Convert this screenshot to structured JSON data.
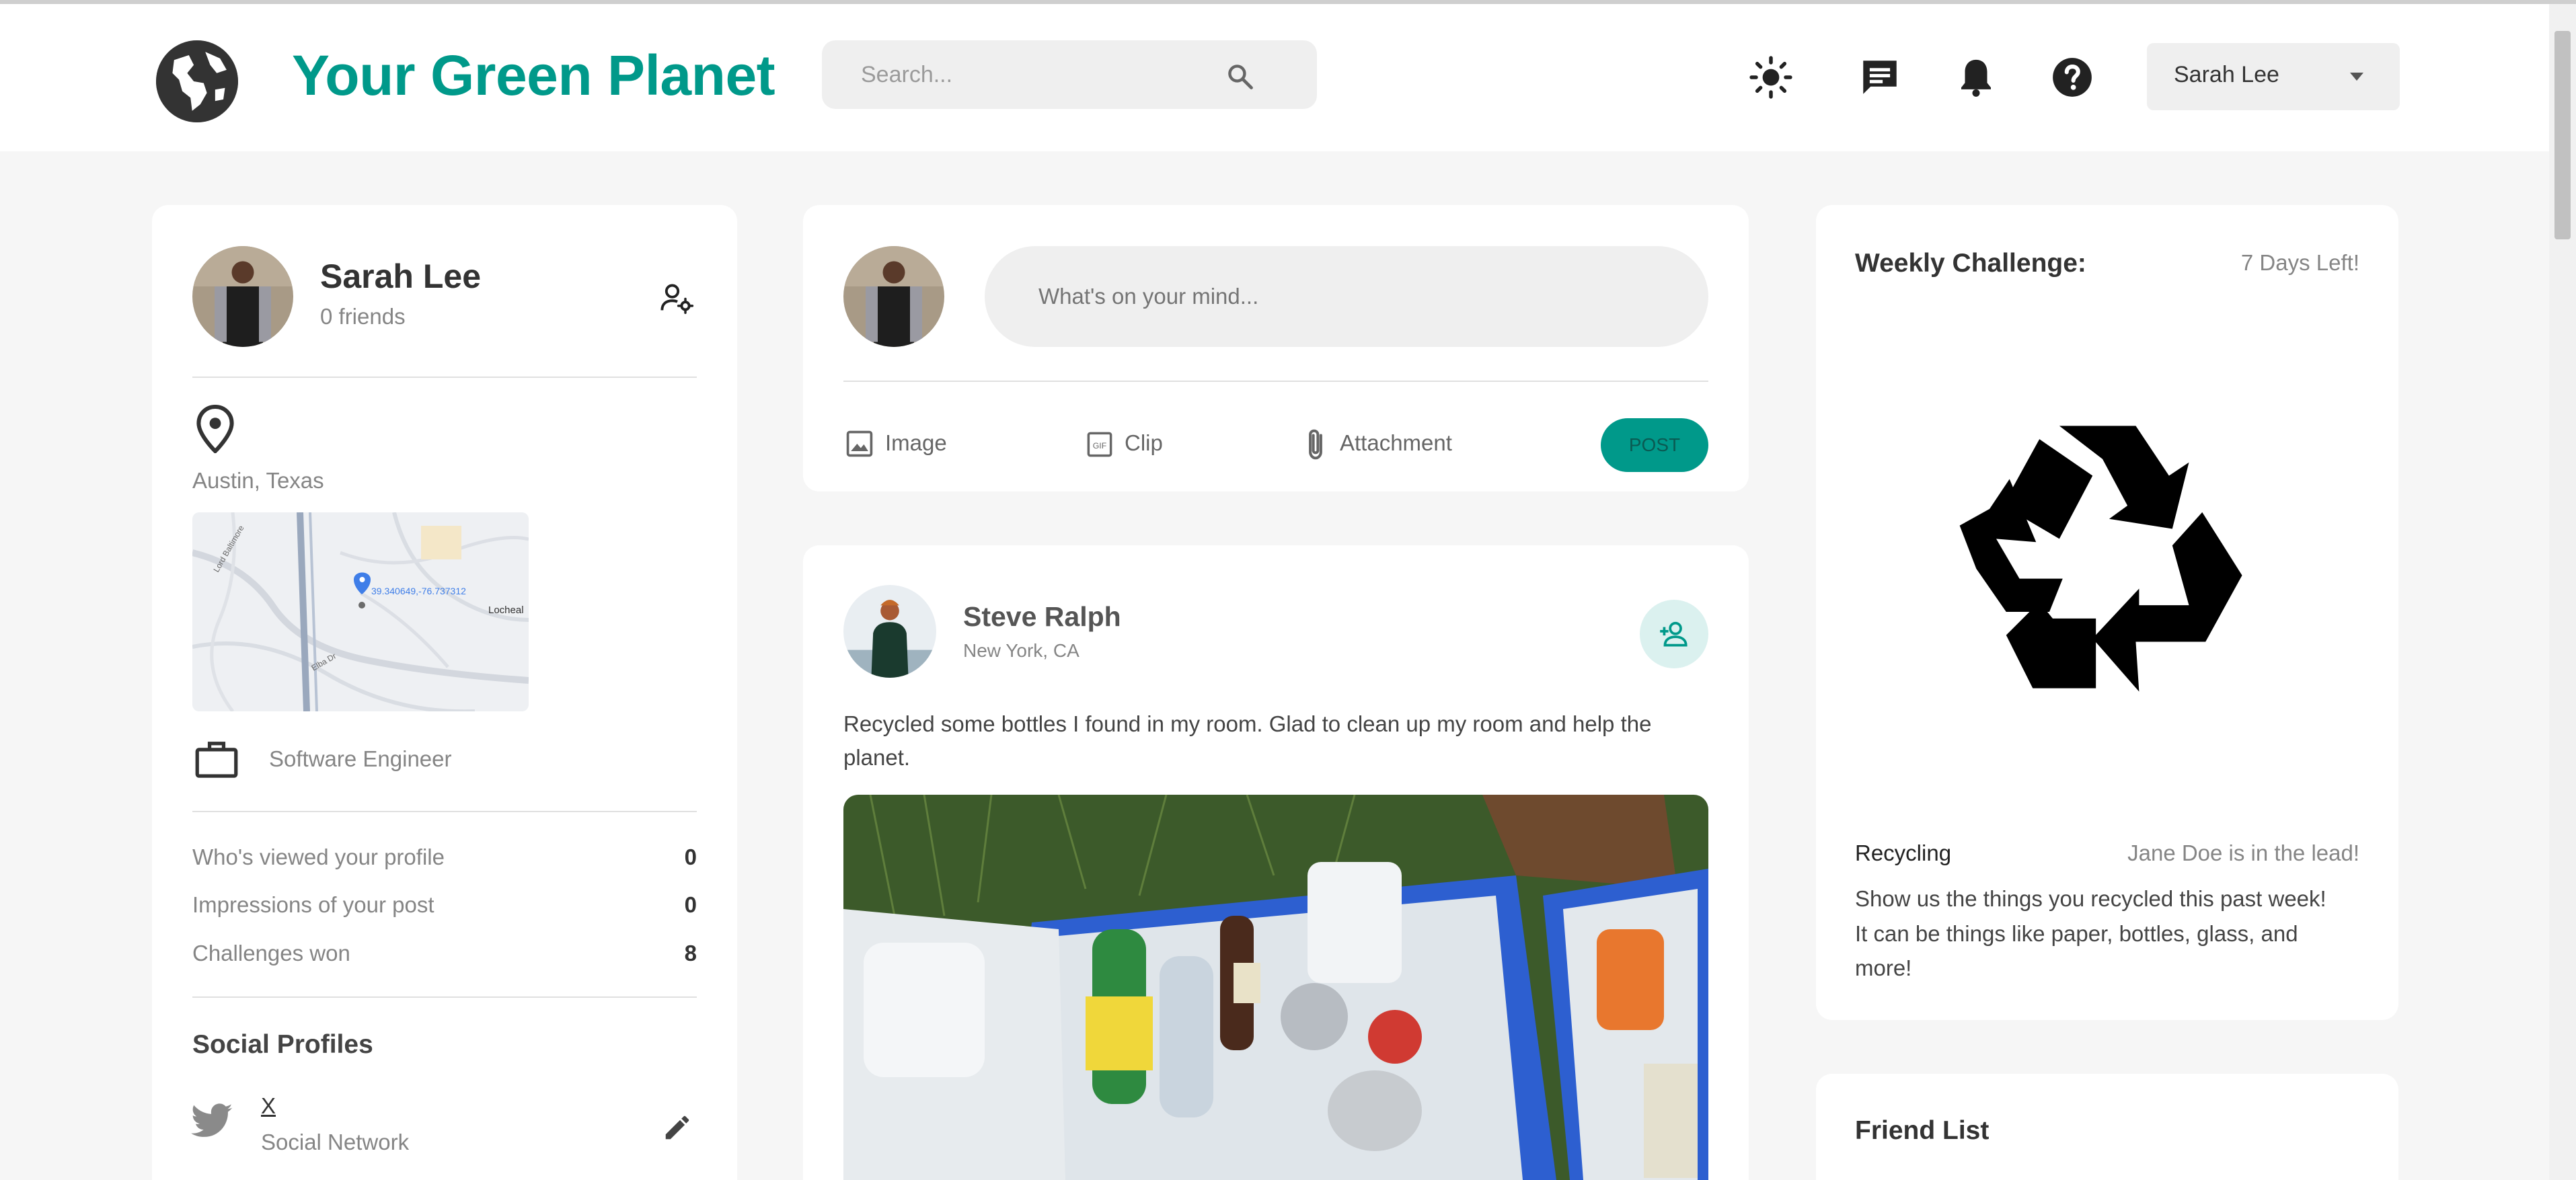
{
  "app": {
    "title": "Your Green Planet",
    "accent_color": "#00998a"
  },
  "header": {
    "search_placeholder": "Search...",
    "icons": [
      "light-mode-icon",
      "message-icon",
      "notification-bell-icon",
      "help-icon"
    ],
    "user_menu": {
      "selected": "Sarah Lee"
    }
  },
  "profile": {
    "name": "Sarah Lee",
    "friends": "0 friends",
    "location": "Austin, Texas",
    "map": {
      "pin_label": "39.340649,-76.737312",
      "place_label": "Locheal",
      "street_labels": [
        "Lord Baltimore",
        "Elba Dr"
      ]
    },
    "occupation": "Software Engineer",
    "stats": [
      {
        "label": "Who's viewed your profile",
        "value": "0"
      },
      {
        "label": "Impressions of your post",
        "value": "0"
      },
      {
        "label": "Challenges won",
        "value": "8"
      }
    ],
    "social_title": "Social Profiles",
    "social": {
      "name": "X",
      "type": "Social Network"
    }
  },
  "composer": {
    "placeholder": "What's on your mind...",
    "actions": {
      "image": "Image",
      "clip": "Clip",
      "attachment": "Attachment"
    },
    "post_label": "POST"
  },
  "post": {
    "author": "Steve Ralph",
    "location": "New York, CA",
    "text": "Recycled some bottles I found in my room. Glad to clean up my room and help the",
    "text2": "planet."
  },
  "challenge": {
    "title": "Weekly Challenge:",
    "days_left": "7 Days Left!",
    "category": "Recycling",
    "leader": "Jane Doe is in the lead!",
    "desc1": "Show us the things you recycled this past week!",
    "desc2": "It can be things like paper, bottles, glass, and",
    "desc3": "more!"
  },
  "friends": {
    "title": "Friend List"
  }
}
